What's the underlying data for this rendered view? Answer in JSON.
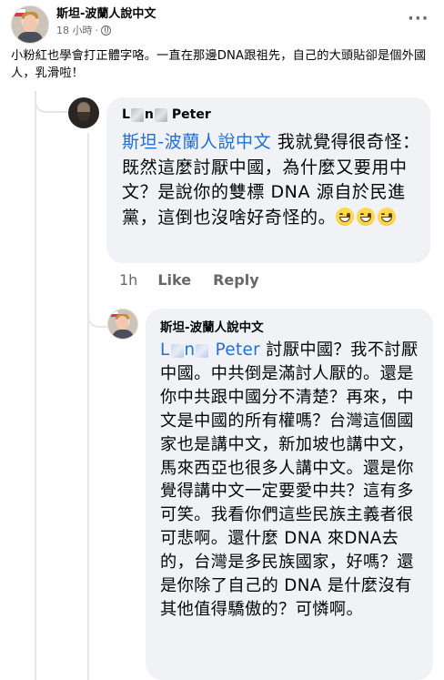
{
  "post": {
    "author": "斯坦-波蘭人說中文",
    "time": "18 小時",
    "separator": "·",
    "body": "小粉紅也學會打正體字咯。一直在那邊DNA跟祖先，自己的大頭貼卻是個外國人，乳滑啦！"
  },
  "comment1": {
    "author_prefix": "L",
    "author_mid": "n",
    "author_suffix": "Peter",
    "mention": "斯坦-波蘭人說中文",
    "text": " 我就覺得很奇怪：既然這麼討厭中國，為什麼又要用中文？是說你的雙標 DNA 源自於民進黨，這倒也沒啥好奇怪的。",
    "time": "1h",
    "like_label": "Like",
    "reply_label": "Reply"
  },
  "comment2": {
    "author": "斯坦-波蘭人說中文",
    "mention_prefix": "L",
    "mention_mid": "n",
    "mention_suffix": "Peter",
    "text": " 討厭中國？我不討厭中國。中共倒是滿討人厭的。還是你中共跟中國分不清楚？再來，中文是中國的所有權嗎？台灣這個國家也是講中文，新加坡也講中文，馬來西亞也很多人講中文。還是你覺得講中文一定要愛中共？這有多可笑。我看你們這些民族主義者很可悲啊。還什麼 DNA 來DNA去的，台灣是多民族國家，好嗎？還是你除了自己的 DNA 是什麼沒有其他值得驕傲的？可憐啊。"
  },
  "icons": {
    "more": "more-horizontal-icon",
    "audience": "globe-icon",
    "emoji": "grinning-face-emoji"
  },
  "colors": {
    "mention": "#216fdb",
    "bubble": "#f0f2f5",
    "meta": "#65676b"
  }
}
